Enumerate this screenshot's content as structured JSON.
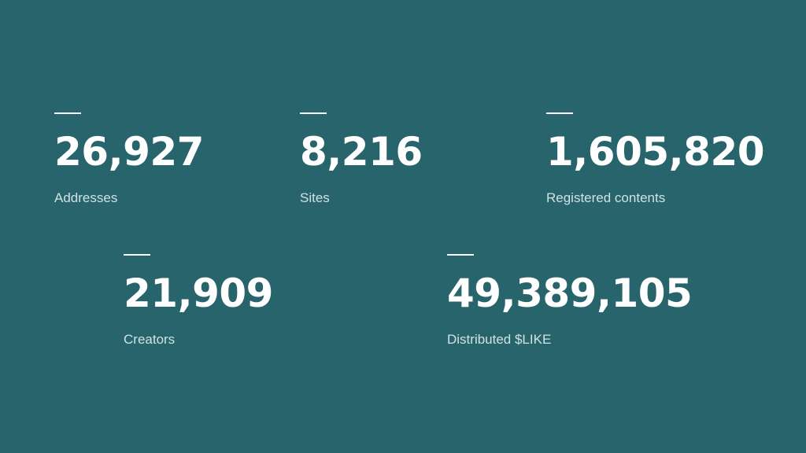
{
  "stats": [
    {
      "value": "26,927",
      "label": "Addresses"
    },
    {
      "value": "8,216",
      "label": "Sites"
    },
    {
      "value": "1,605,820",
      "label": "Registered contents"
    },
    {
      "value": "21,909",
      "label": "Creators"
    },
    {
      "value": "49,389,105",
      "label": "Distributed $LIKE"
    }
  ],
  "colors": {
    "background": "#28646c",
    "text": "#ffffff",
    "label": "#cfe2e4"
  }
}
